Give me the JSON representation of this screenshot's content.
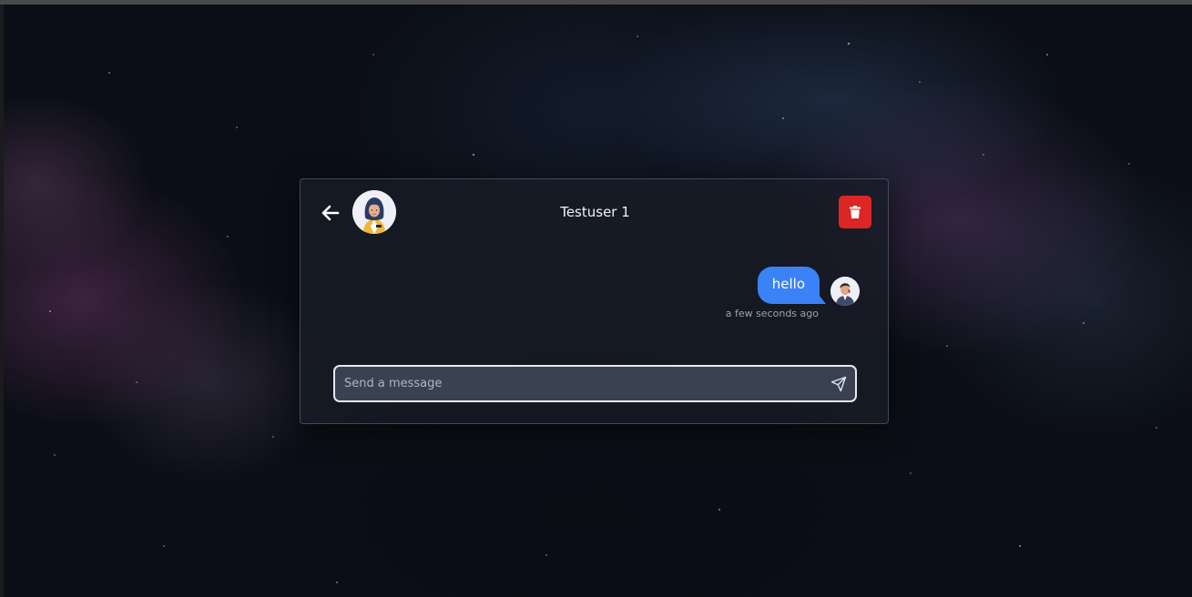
{
  "chat": {
    "title": "Testuser 1",
    "contact_avatar_icon": "avatar-woman-hijab",
    "back_icon": "arrow-left-icon",
    "delete_icon": "trash-icon",
    "delete_color": "#dc2626"
  },
  "messages": [
    {
      "text": "hello",
      "time": "a few seconds ago",
      "direction": "outgoing",
      "bubble_color": "#3b82f6",
      "avatar_icon": "avatar-man"
    }
  ],
  "composer": {
    "placeholder": "Send a message",
    "value": "",
    "send_icon": "send-icon"
  }
}
